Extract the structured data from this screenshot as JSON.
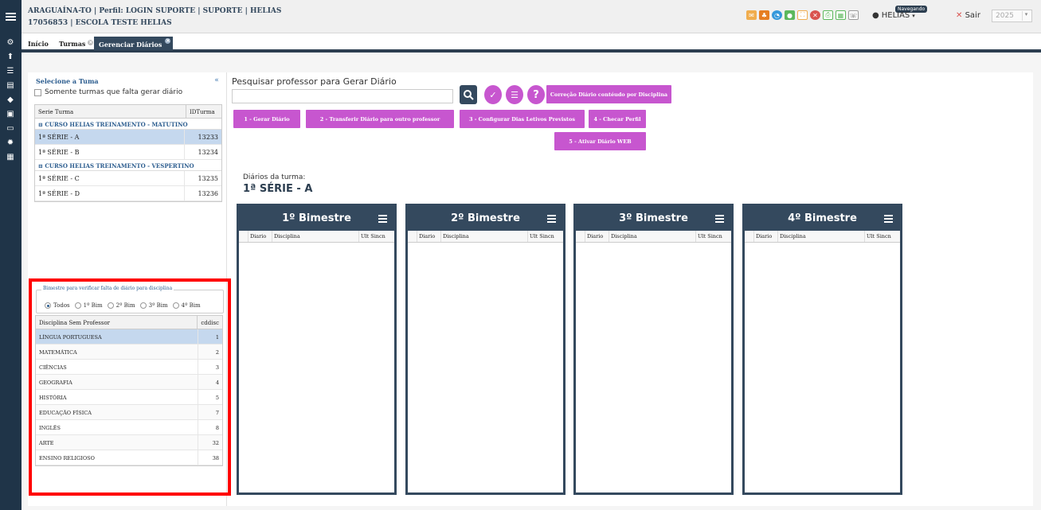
{
  "header": {
    "line1": "ARAGUAÍNA-TO | Perfil: LOGIN SUPORTE | SUPORTE | HELIAS",
    "line2": "17056853 | ESCOLA TESTE HELIAS",
    "user_name": "HELIAS",
    "status_badge": "Navegando",
    "logout_label": "Sair",
    "year": "2025"
  },
  "toolbar_icons": [
    {
      "name": "envelope-icon",
      "color": "#f0ad4e"
    },
    {
      "name": "sitemap-icon",
      "color": "#e67e22"
    },
    {
      "name": "pie-chart-icon",
      "color": "#3498db"
    },
    {
      "name": "chat-icon",
      "color": "#5cb85c"
    },
    {
      "name": "expand-icon",
      "color": "#f0ad4e"
    },
    {
      "name": "close-circle-icon",
      "color": "#d9534f"
    },
    {
      "name": "print-icon",
      "color": "#5cb85c"
    },
    {
      "name": "grid-icon",
      "color": "#5cb85c"
    },
    {
      "name": "whatsapp-icon",
      "color": "#666"
    }
  ],
  "tabs": [
    {
      "label": "Início"
    },
    {
      "label": "Turmas"
    },
    {
      "label": "Gerenciar Diários"
    }
  ],
  "left_panel": {
    "title": "Selecione a Tuma",
    "checkbox_label": "Somente turmas que falta gerar diário",
    "col_serie": "Serie Turma",
    "col_id": "IDTurma",
    "groups": [
      {
        "name": "CURSO HELIAS TREINAMENTO - MATUTINO",
        "rows": [
          {
            "serie": "1ª SÉRIE - A",
            "id": "13233"
          },
          {
            "serie": "1ª SÉRIE - B",
            "id": "13234"
          }
        ]
      },
      {
        "name": "CURSO HELIAS TREINAMENTO - VESPERTINO",
        "rows": [
          {
            "serie": "1ª SÉRIE - C",
            "id": "13235"
          },
          {
            "serie": "1ª SÉRIE - D",
            "id": "13236"
          }
        ]
      }
    ],
    "bimestre_legend": "Bimestre para verificar falta de diário para disciplina",
    "radios": [
      "Todos",
      "1º Bim",
      "2º Bim",
      "3º Bim",
      "4º Bim"
    ],
    "selected_radio": "Todos",
    "col_disciplina": "Disciplina Sem Professor",
    "col_cddisc": "cddisc",
    "disciplinas": [
      {
        "nome": "LÍNGUA PORTUGUESA",
        "cd": "1"
      },
      {
        "nome": "MATEMÁTICA",
        "cd": "2"
      },
      {
        "nome": "CIÊNCIAS",
        "cd": "3"
      },
      {
        "nome": "GEOGRAFIA",
        "cd": "4"
      },
      {
        "nome": "HISTÓRIA",
        "cd": "5"
      },
      {
        "nome": "EDUCAÇÃO FÍSICA",
        "cd": "7"
      },
      {
        "nome": "INGLÊS",
        "cd": "8"
      },
      {
        "nome": "ARTE",
        "cd": "32"
      },
      {
        "nome": "ENSINO RELIGIOSO",
        "cd": "38"
      }
    ]
  },
  "main": {
    "search_label": "Pesquisar professor para Gerar Diário",
    "search_value": "",
    "btn_correcao": "Correção Diário contéudo por Disciplina",
    "btn_gerar": "1 - Gerar Diário",
    "btn_transferir": "2 - Transferir Diário para outro professor",
    "btn_configurar": "3 - Configurar Dias Letivos Previstos",
    "btn_checar": "4 - Checar Perfil",
    "btn_ativar": "5 - Ativar Diário WEB",
    "diarios_label": "Diários da turma:",
    "turma_selected": "1ª SÉRIE - A",
    "bimestres": [
      {
        "title": "1º Bimestre"
      },
      {
        "title": "2º Bimestre"
      },
      {
        "title": "3º Bimestre"
      },
      {
        "title": "4º Bimestre"
      }
    ],
    "col_diario": "Diario",
    "col_disciplina": "Disciplina",
    "col_ult": "Ult Sincn"
  },
  "colors": {
    "navy": "#34495e",
    "magenta": "#c756cf",
    "highlight": "#ff0000",
    "selection": "#c5d8ee"
  }
}
